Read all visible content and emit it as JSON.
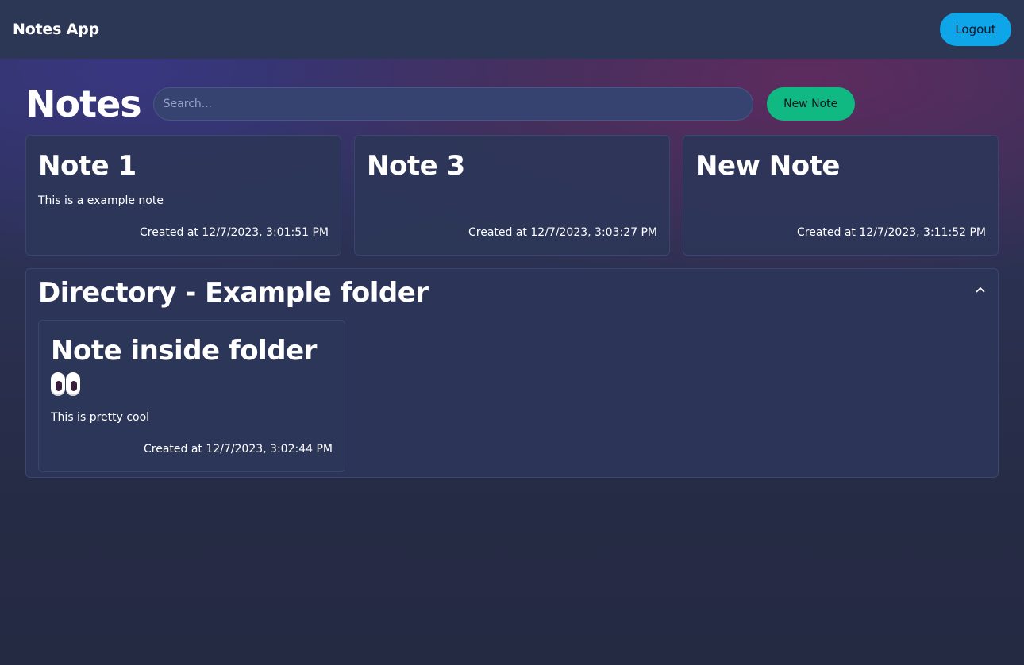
{
  "navbar": {
    "brand": "Notes App",
    "logout_label": "Logout"
  },
  "header": {
    "title": "Notes",
    "search_placeholder": "Search...",
    "new_note_label": "New Note"
  },
  "notes": [
    {
      "title": "Note 1",
      "body": "This is a example note",
      "created": "Created at 12/7/2023, 3:01:51 PM"
    },
    {
      "title": "Note 3",
      "body": "",
      "created": "Created at 12/7/2023, 3:03:27 PM"
    },
    {
      "title": "New Note",
      "body": "",
      "created": "Created at 12/7/2023, 3:11:52 PM"
    }
  ],
  "folder": {
    "title": "Directory - Example folder",
    "toggle_icon": "chevron-up-icon",
    "notes": [
      {
        "title": "Note inside folder",
        "emoji": "eyes-emoji",
        "body": "This is pretty cool",
        "created": "Created at 12/7/2023, 3:02:44 PM"
      }
    ]
  },
  "colors": {
    "logout_button": "#0ea5e9",
    "new_note_button": "#10b981",
    "navbar": "#2c3655",
    "card": "#2c3658"
  }
}
